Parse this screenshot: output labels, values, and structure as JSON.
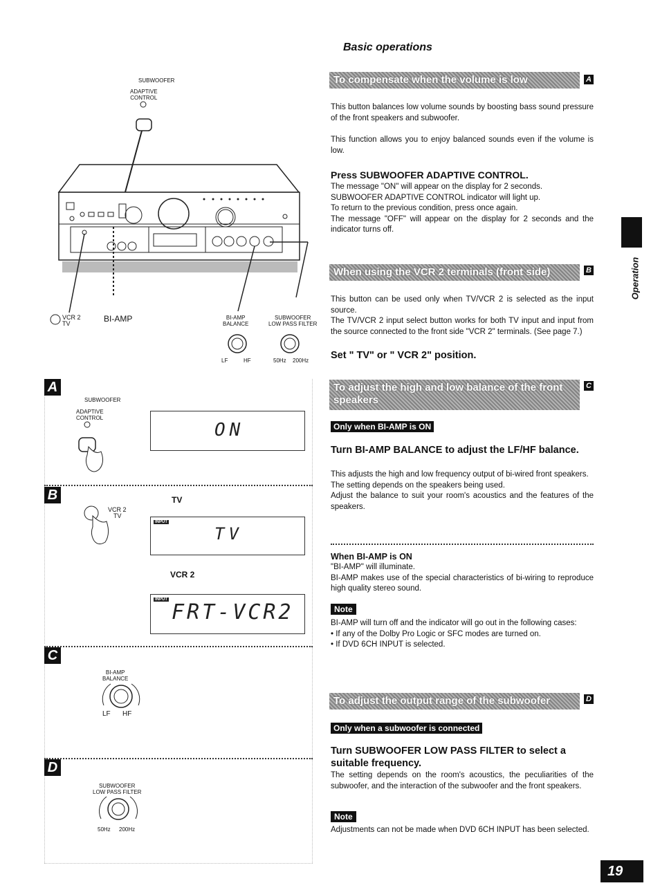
{
  "header": {
    "section_title": "Basic operations"
  },
  "side_tab": {
    "label": "Operation"
  },
  "page_number": "19",
  "diagram": {
    "top": {
      "subwoofer_label": "SUBWOOFER",
      "adaptive_control_label": "ADAPTIVE\nCONTROL",
      "vcr2_label": "VCR 2",
      "tv_label": "TV",
      "bi_amp_label": "BI-AMP",
      "bi_amp_balance_label": "BI-AMP\nBALANCE",
      "lf_label": "LF",
      "hf_label": "HF",
      "subwoofer_lpf_label": "SUBWOOFER\nLOW PASS FILTER",
      "hz50_label": "50Hz",
      "hz200_label": "200Hz"
    },
    "panel_a": {
      "badge": "A",
      "subwoofer_label": "SUBWOOFER",
      "adaptive_control_label": "ADAPTIVE\nCONTROL",
      "display_text": "ON"
    },
    "panel_b": {
      "badge": "B",
      "vcr2_label": "VCR 2",
      "tv_label": "TV",
      "tv_heading": "TV",
      "tv_display": "TV",
      "vcr2_heading": "VCR 2",
      "vcr2_display": "FRT-VCR2",
      "input_tag": "INPUT"
    },
    "panel_c": {
      "badge": "C",
      "knob_label": "BI-AMP\nBALANCE",
      "lf_label": "LF",
      "hf_label": "HF"
    },
    "panel_d": {
      "badge": "D",
      "knob_label": "SUBWOOFER\nLOW PASS FILTER",
      "hz50_label": "50Hz",
      "hz200_label": "200Hz"
    }
  },
  "sections": {
    "a": {
      "banner": "To compensate when the volume is low",
      "badge": "A",
      "p1": "This button balances low volume sounds by boosting bass sound pressure of the front speakers and subwoofer.",
      "p2": "This function allows you to enjoy balanced sounds even if the volume is low.",
      "step": "Press SUBWOOFER ADAPTIVE CONTROL.",
      "body": [
        "The message \"ON\" will appear on the display for 2 seconds.",
        "SUBWOOFER ADAPTIVE CONTROL indicator will light up.",
        "To return to the previous condition, press once again.",
        "The message \"OFF\" will appear on the display for 2 seconds and the indicator turns off."
      ]
    },
    "b": {
      "banner": "When using the VCR 2 terminals (front side)",
      "badge": "B",
      "p1": "This button can be used only when TV/VCR 2 is selected as the input source.",
      "p2": "The TV/VCR 2 input select button works for both TV input and input from the source connected to the front side \"VCR 2\" terminals. (See page 7.)",
      "step": "Set \" TV\" or \" VCR 2\" position."
    },
    "c": {
      "banner": "To adjust the high and low balance of the front speakers",
      "badge": "C",
      "condition_tag": "Only when BI-AMP is ON",
      "step": "Turn BI-AMP BALANCE to adjust the LF/HF balance.",
      "body": [
        "This adjusts the high and low frequency output of bi-wired front speakers.",
        "The setting depends on the speakers being used.",
        "Adjust the balance to suit your room's acoustics and the features of the speakers."
      ],
      "sub_heading": "When BI-AMP is ON",
      "sub_body": [
        "\"BI-AMP\" will illuminate.",
        "BI-AMP makes use of the special characteristics of bi-wiring to reproduce high quality stereo sound."
      ],
      "note_label": "Note",
      "note_intro": "BI-AMP will turn off and the indicator will go out in the following cases:",
      "note_bullets": [
        "If any of the Dolby Pro Logic or SFC modes are turned on.",
        "If DVD 6CH INPUT is selected."
      ]
    },
    "d": {
      "banner": "To adjust the output range of the subwoofer",
      "badge": "D",
      "condition_tag": "Only when a subwoofer is connected",
      "step": "Turn SUBWOOFER LOW PASS FILTER to select a suitable frequency.",
      "body": "The setting depends on the room's acoustics, the peculiarities of the subwoofer, and the interaction of the subwoofer and the front speakers.",
      "note_label": "Note",
      "note_text": "Adjustments can not be made when DVD 6CH INPUT has been selected."
    }
  }
}
